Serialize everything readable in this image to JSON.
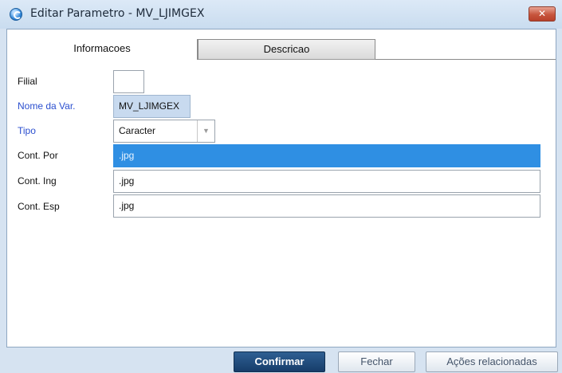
{
  "window": {
    "title": "Editar Parametro - MV_LJIMGEX",
    "close_glyph": "✕"
  },
  "tabs": [
    {
      "label": "Informacoes",
      "active": true
    },
    {
      "label": "Descricao",
      "active": false
    }
  ],
  "fields": {
    "filial": {
      "label": "Filial",
      "value": ""
    },
    "nome_var": {
      "label": "Nome da Var.",
      "value": "MV_LJIMGEX"
    },
    "tipo": {
      "label": "Tipo",
      "value": "Caracter",
      "arrow": "▼"
    },
    "cont_por": {
      "label": "Cont. Por",
      "value": ".jpg"
    },
    "cont_ing": {
      "label": "Cont. Ing",
      "value": ".jpg"
    },
    "cont_esp": {
      "label": "Cont. Esp",
      "value": ".jpg"
    }
  },
  "buttons": {
    "confirm": "Confirmar",
    "close": "Fechar",
    "actions": "Ações relacionadas"
  },
  "colors": {
    "title_bar": "#c9dcef",
    "required_label": "#2b4fcf",
    "selected_field": "#2f8fe3",
    "primary_button": "#173d6a"
  }
}
